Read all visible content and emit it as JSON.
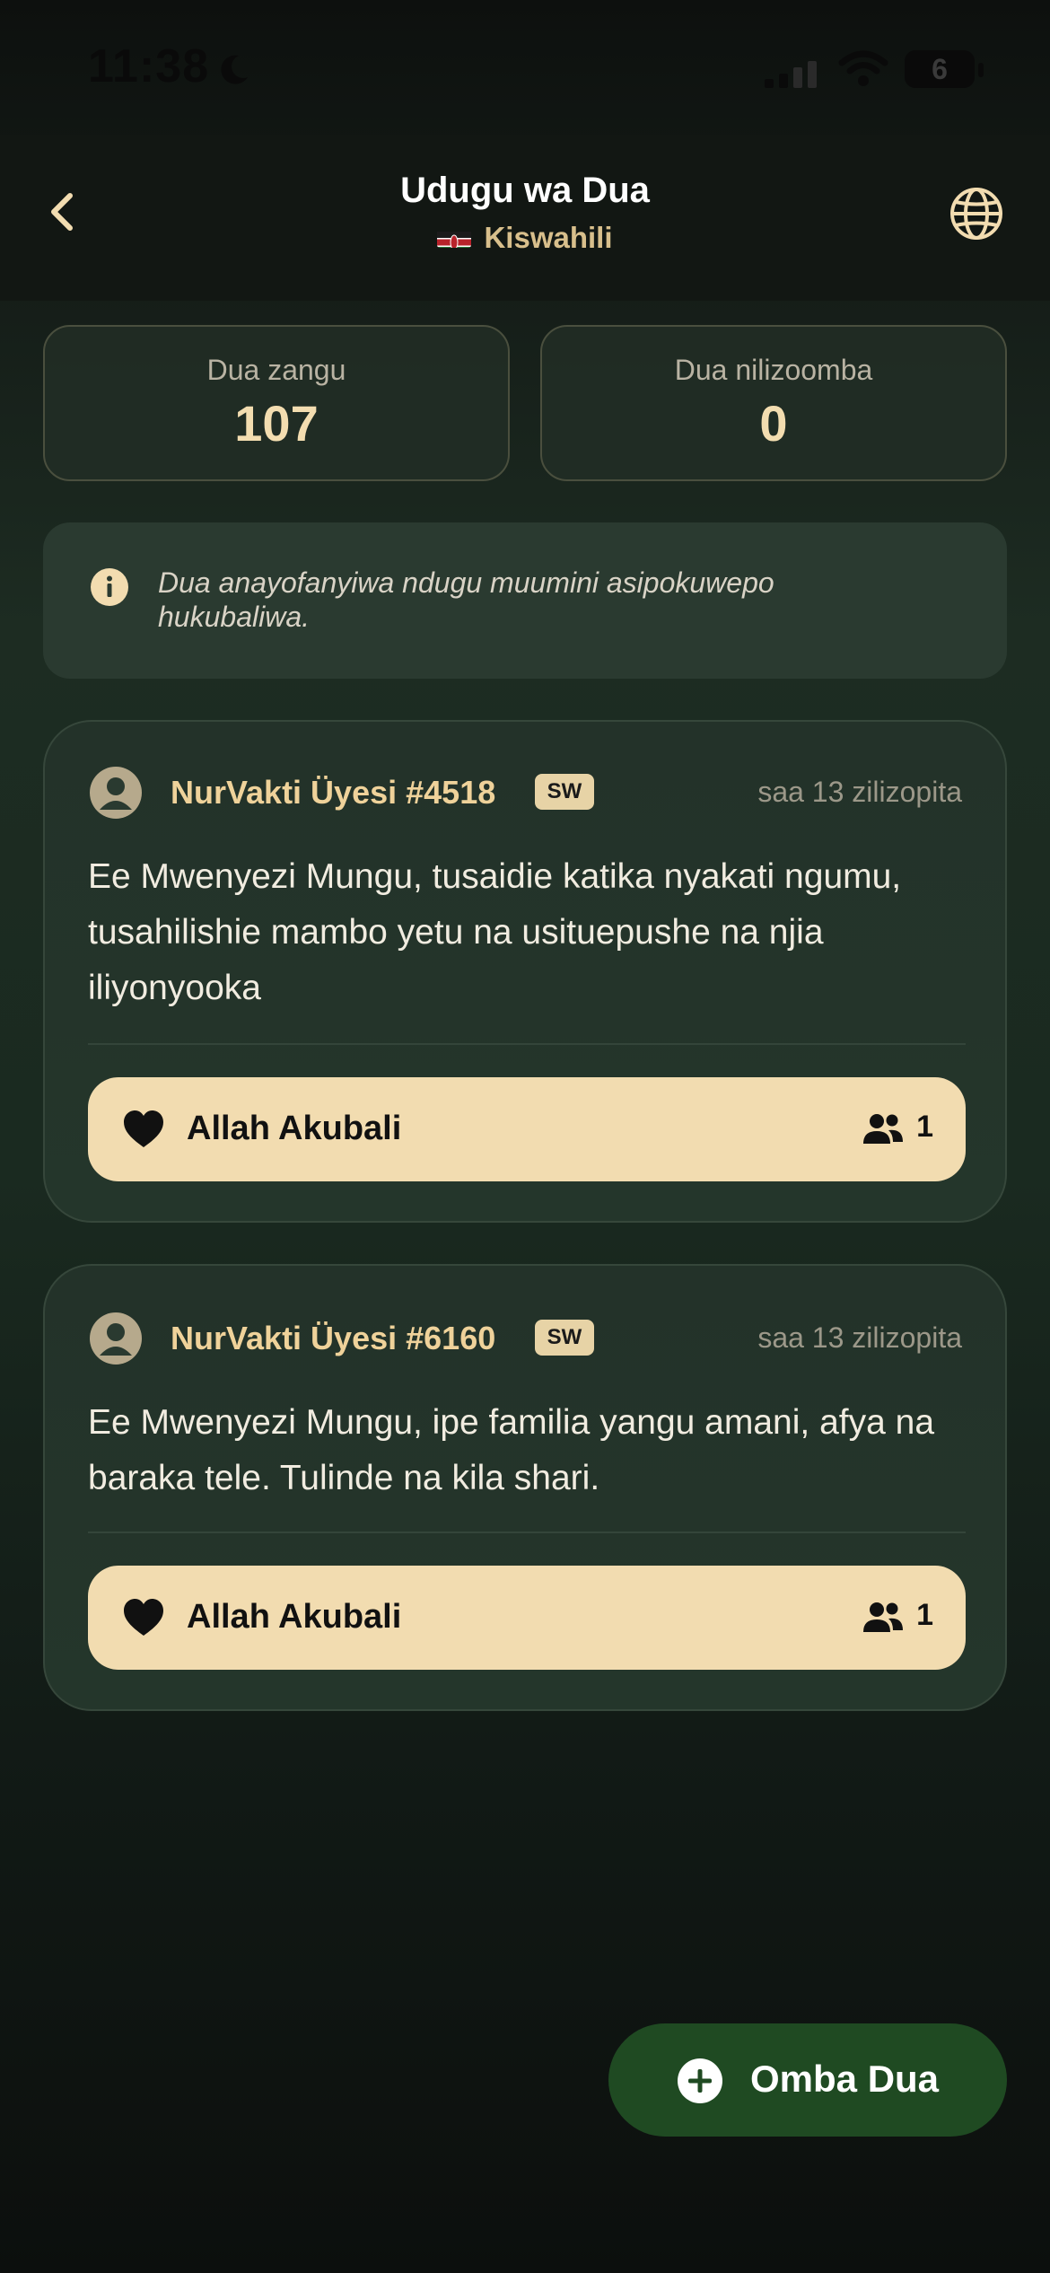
{
  "status_bar": {
    "time": "11:38",
    "battery": "6"
  },
  "header": {
    "title": "Udugu wa Dua",
    "language": "Kiswahili",
    "back_icon": "chevron-left-icon",
    "globe_icon": "globe-icon"
  },
  "stats": [
    {
      "label": "Dua zangu",
      "value": "107"
    },
    {
      "label": "Dua nilizoomba",
      "value": "0"
    }
  ],
  "info": {
    "text": "Dua anayofanyiwa ndugu muumini asipokuwepo hukubaliwa."
  },
  "duas": [
    {
      "user": "NurVakti Üyesi #4518",
      "lang": "SW",
      "time": "saa 13 zilizopita",
      "text": "Ee Mwenyezi Mungu, tusaidie katika nyakati ngumu, tusahilishie mambo yetu na usituepushe na njia iliyonyooka",
      "amen_label": "Allah Akubali",
      "amen_count": "1"
    },
    {
      "user": "NurVakti Üyesi #6160",
      "lang": "SW",
      "time": "saa 13 zilizopita",
      "text": "Ee Mwenyezi Mungu, ipe familia yangu amani, afya na baraka tele. Tulinde na kila shari.",
      "amen_label": "Allah Akubali",
      "amen_count": "1"
    }
  ],
  "fab": {
    "label": "Omba Dua"
  },
  "colors": {
    "accent": "#f2dcb0",
    "gold_text": "#efd29a",
    "fab_bg": "#1f4a22"
  }
}
